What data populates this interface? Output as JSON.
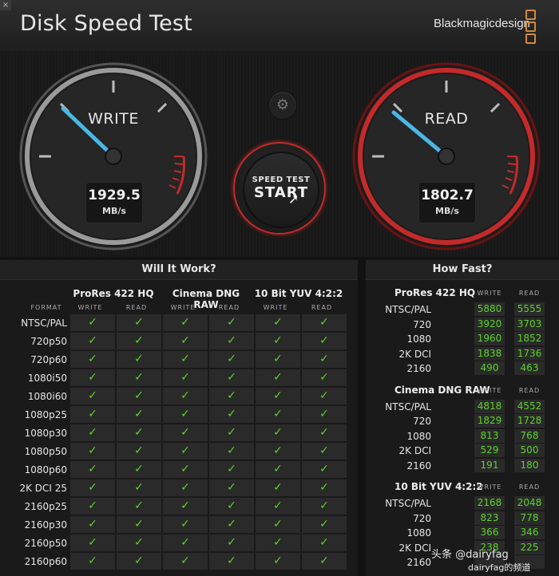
{
  "window": {
    "close_glyph": "×"
  },
  "header": {
    "title": "Disk Speed Test",
    "brand": "Blackmagicdesign"
  },
  "write_gauge": {
    "label": "WRITE",
    "value": "1929.5",
    "unit": "MB/s"
  },
  "read_gauge": {
    "label": "READ",
    "value": "1802.7",
    "unit": "MB/s"
  },
  "start_button": {
    "small": "SPEED TEST",
    "big": "START"
  },
  "will_it_work": {
    "title": "Will It Work?",
    "format_label": "FORMAT",
    "groups": [
      {
        "name": "ProRes 422 HQ",
        "write": "WRITE",
        "read": "READ"
      },
      {
        "name": "Cinema DNG RAW",
        "write": "WRITE",
        "read": "READ"
      },
      {
        "name": "10 Bit YUV 4:2:2",
        "write": "WRITE",
        "read": "READ"
      }
    ],
    "check": "✓",
    "formats": [
      "NTSC/PAL",
      "720p50",
      "720p60",
      "1080i50",
      "1080i60",
      "1080p25",
      "1080p30",
      "1080p50",
      "1080p60",
      "2K DCI 25",
      "2160p25",
      "2160p30",
      "2160p50",
      "2160p60"
    ]
  },
  "how_fast": {
    "title": "How Fast?",
    "write_label": "WRITE",
    "read_label": "READ",
    "sections": [
      {
        "name": "ProRes 422 HQ",
        "rows": [
          {
            "name": "NTSC/PAL",
            "write": "5880",
            "read": "5555"
          },
          {
            "name": "720",
            "write": "3920",
            "read": "3703"
          },
          {
            "name": "1080",
            "write": "1960",
            "read": "1852"
          },
          {
            "name": "2K DCI",
            "write": "1838",
            "read": "1736"
          },
          {
            "name": "2160",
            "write": "490",
            "read": "463"
          }
        ]
      },
      {
        "name": "Cinema DNG RAW",
        "rows": [
          {
            "name": "NTSC/PAL",
            "write": "4818",
            "read": "4552"
          },
          {
            "name": "720",
            "write": "1829",
            "read": "1728"
          },
          {
            "name": "1080",
            "write": "813",
            "read": "768"
          },
          {
            "name": "2K DCI",
            "write": "529",
            "read": "500"
          },
          {
            "name": "2160",
            "write": "191",
            "read": "180"
          }
        ]
      },
      {
        "name": "10 Bit YUV 4:2:2",
        "rows": [
          {
            "name": "NTSC/PAL",
            "write": "2168",
            "read": "2048"
          },
          {
            "name": "720",
            "write": "823",
            "read": "778"
          },
          {
            "name": "1080",
            "write": "366",
            "read": "346"
          },
          {
            "name": "2K DCI",
            "write": "238",
            "read": "225"
          },
          {
            "name": "2160",
            "write": "",
            "read": ""
          }
        ]
      }
    ]
  },
  "watermark": {
    "line1": "头条 @dairyfag",
    "line2": "dairyfag的频道"
  },
  "colors": {
    "accent_red": "#c42a2a",
    "needle": "#49b8e6",
    "check_green": "#5cd32a",
    "brand_orange": "#d08a3a"
  }
}
